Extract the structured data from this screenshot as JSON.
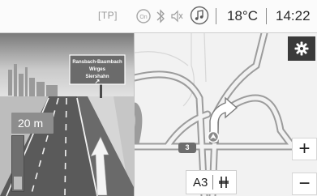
{
  "status_bar": {
    "tp_label": "[TP]",
    "icons": [
      "radio-on-icon",
      "bluetooth-icon",
      "mute-icon",
      "music-icon"
    ],
    "temperature": "18°C",
    "time": "14:22"
  },
  "junction_view": {
    "sign_lines": [
      "Ransbach-Baumbach",
      "Wirges",
      "Siershahn"
    ],
    "sign_arrow": "↗",
    "distance": "20 m",
    "distance_progress": 0.25
  },
  "map": {
    "road_number": "3",
    "route_name": "A3",
    "route_icon": "motorway-junction-icon",
    "settings_icon": "gear-icon",
    "zoom_in_label": "+",
    "zoom_out_label": "−"
  }
}
